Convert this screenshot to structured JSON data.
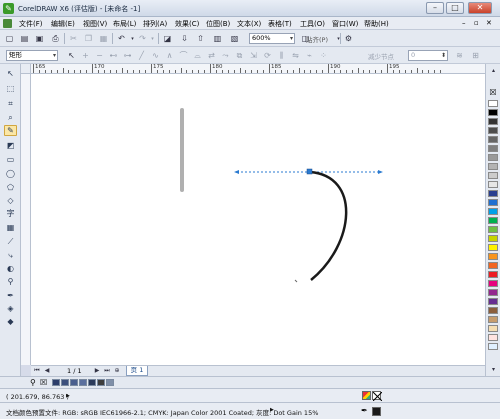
{
  "window": {
    "title": "CorelDRAW X6 (评估版) - [未命名 -1]",
    "app_icon": "coreldraw-logo"
  },
  "menu": {
    "items": [
      "文件(F)",
      "编辑(E)",
      "视图(V)",
      "布局(L)",
      "排列(A)",
      "效果(C)",
      "位图(B)",
      "文本(X)",
      "表格(T)",
      "工具(O)",
      "窗口(W)",
      "帮助(H)"
    ]
  },
  "standard_toolbar": {
    "zoom_value": "600%",
    "snap_label": "贴齐(P)"
  },
  "property_bar": {
    "object_type": "矩形",
    "reduce_nodes_label": "减少节点",
    "reduce_nodes_value": "0"
  },
  "rulers": {
    "horizontal_labels": [
      "165",
      "170",
      "175",
      "180",
      "185",
      "190",
      "195"
    ]
  },
  "page_navigator": {
    "page_count": "1 / 1",
    "page_tab": "页 1"
  },
  "status": {
    "coordinates": "( 201.679, 86.763 )",
    "color_profile": "文档颜色预置文件: RGB: sRGB IEC61966-2.1; CMYK: Japan Color 2001 Coated; 灰度: Dot Gain 15%"
  },
  "colors": {
    "accent": "#3a9a2a",
    "selection_handle": "#2a7ad0",
    "curve": "#1a1a1a",
    "gray_stroke": "#b0b0b0"
  },
  "palette_colors": [
    "#ffffff",
    "#000000",
    "#333333",
    "#4d4d4d",
    "#666666",
    "#808080",
    "#999999",
    "#b3b3b3",
    "#cccccc",
    "#e6e6e6",
    "#2a3f8f",
    "#1f6fd1",
    "#00a0e9",
    "#00b050",
    "#70bf44",
    "#c8d400",
    "#fff200",
    "#f7941d",
    "#f26522",
    "#ed1c24",
    "#e6007e",
    "#92278f",
    "#662d91",
    "#8b5e3c",
    "#c69c6d",
    "#f5deb3",
    "#ffe4e1",
    "#e0f0ff"
  ],
  "doc_palette_colors": [
    "#2c3e6b",
    "#3b4f7d",
    "#4a5f8e",
    "#5a6f9e",
    "#2b3a5a",
    "#3d3d3d",
    "#7f8fa8"
  ]
}
